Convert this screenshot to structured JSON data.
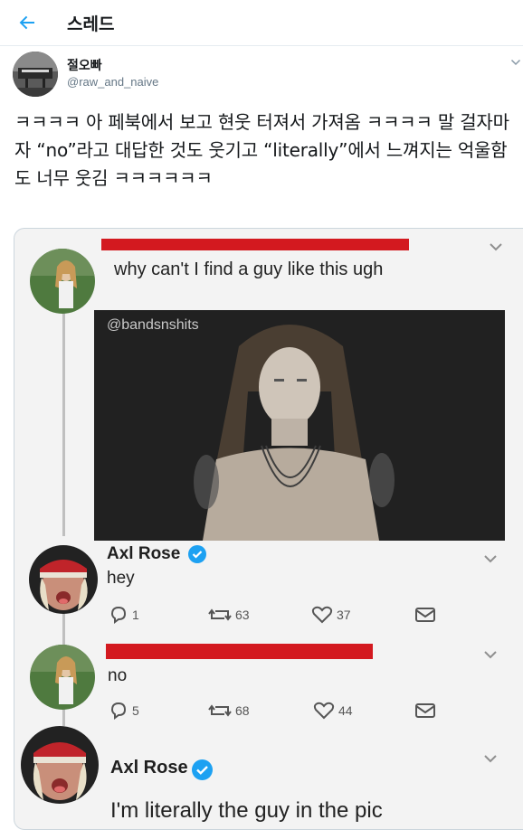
{
  "header": {
    "title": "스레드",
    "back_icon": "arrow-left-icon",
    "accent": "#1da1f2"
  },
  "author": {
    "name": "절오빠",
    "handle": "@raw_and_naive"
  },
  "tweet": {
    "text": "ㅋㅋㅋㅋ 아 페북에서 보고 현웃 터져서 가져옴 ㅋㅋㅋㅋ 말 걸자마자 “no”라고 대답한 것도 웃기고 “literally”에서 느껴지는 억울함도 너무 웃김 ㅋㅋㅋㅋㅋㅋ"
  },
  "embedded": {
    "post1": {
      "text": "why can't I find a guy like this ugh",
      "watermark": "@bandsnshits"
    },
    "reply1": {
      "name": "Axl Rose",
      "text": "hey",
      "replies": "1",
      "retweets": "63",
      "likes": "37"
    },
    "reply2": {
      "text": "no",
      "replies": "5",
      "retweets": "68",
      "likes": "44"
    },
    "reply3": {
      "name": "Axl Rose",
      "text": "I'm literally the guy in the pic"
    }
  }
}
